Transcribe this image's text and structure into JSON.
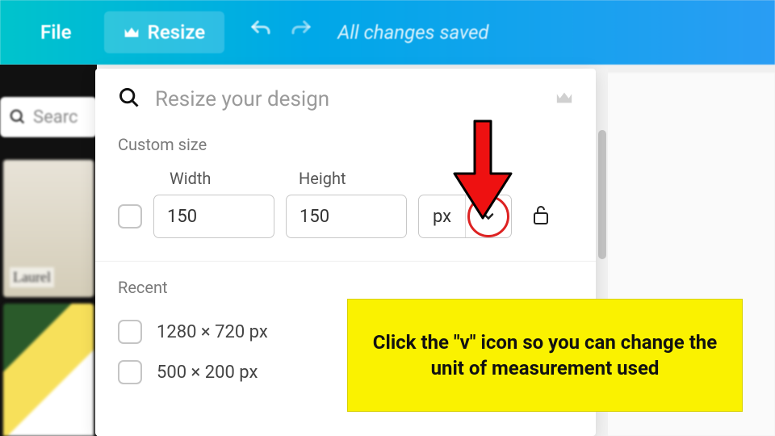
{
  "topbar": {
    "file_label": "File",
    "resize_label": "Resize",
    "saved_text": "All changes saved"
  },
  "left": {
    "search_placeholder": "Searc"
  },
  "panel": {
    "search_placeholder": "Resize your design",
    "custom_label": "Custom size",
    "width_label": "Width",
    "height_label": "Height",
    "width_value": "150",
    "height_value": "150",
    "unit_label": "px",
    "recent_label": "Recent",
    "recent_items": [
      "1280 × 720 px",
      "500 × 200 px"
    ]
  },
  "annotation": {
    "callout_text": "Click the \"v\" icon so you can change the unit of measurement used"
  }
}
